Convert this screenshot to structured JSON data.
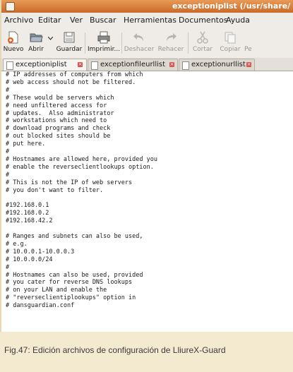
{
  "window": {
    "title": "exceptioniplist (/usr/share/"
  },
  "menubar": {
    "items": [
      "Archivo",
      "Editar",
      "Ver",
      "Buscar",
      "Herramientas",
      "Documentos",
      "Ayuda"
    ]
  },
  "toolbar": {
    "new_label": "Nuevo",
    "open_label": "Abrir",
    "save_label": "Guardar",
    "print_label": "Imprimir...",
    "undo_label": "Deshacer",
    "redo_label": "Rehacer",
    "cut_label": "Cortar",
    "copy_label": "Copiar",
    "paste_label": "Pe"
  },
  "tabs": [
    {
      "label": "exceptioniplist"
    },
    {
      "label": "exceptionfileurllist"
    },
    {
      "label": "exceptionurllist"
    }
  ],
  "editor": {
    "text": "# IP addresses of computers from which\n# web access should not be filtered.\n#\n# These would be servers which\n# need unfiltered access for\n# updates.  Also administrator\n# workstations which need to\n# download programs and check\n# out blocked sites should be\n# put here.\n#\n# Hostnames are allowed here, provided you\n# enable the reverseclientlookups option.\n#\n# This is not the IP of web servers\n# you don't want to filter.\n\n#192.168.0.1\n#192.168.0.2\n#192.168.42.2\n\n# Ranges and subnets can also be used,\n# e.g.\n# 10.0.0.1-10.0.0.3\n# 10.0.0.0/24\n#\n# Hostnames can also be used, provided\n# you cater for reverse DNS lookups\n# on your LAN and enable the\n# \"reverseclientiplookups\" option in\n# dansguardian.conf"
  },
  "caption": "Fig.47: Edición archivos de configuración de LliureX-Guard",
  "colors": {
    "titlebar": "#d9803e",
    "page_background": "#f4ead0",
    "tab_close": "#d9534f"
  },
  "icons": [
    "new-document-icon",
    "open-folder-icon",
    "save-icon",
    "print-icon",
    "undo-icon",
    "redo-icon",
    "cut-icon",
    "copy-icon"
  ]
}
